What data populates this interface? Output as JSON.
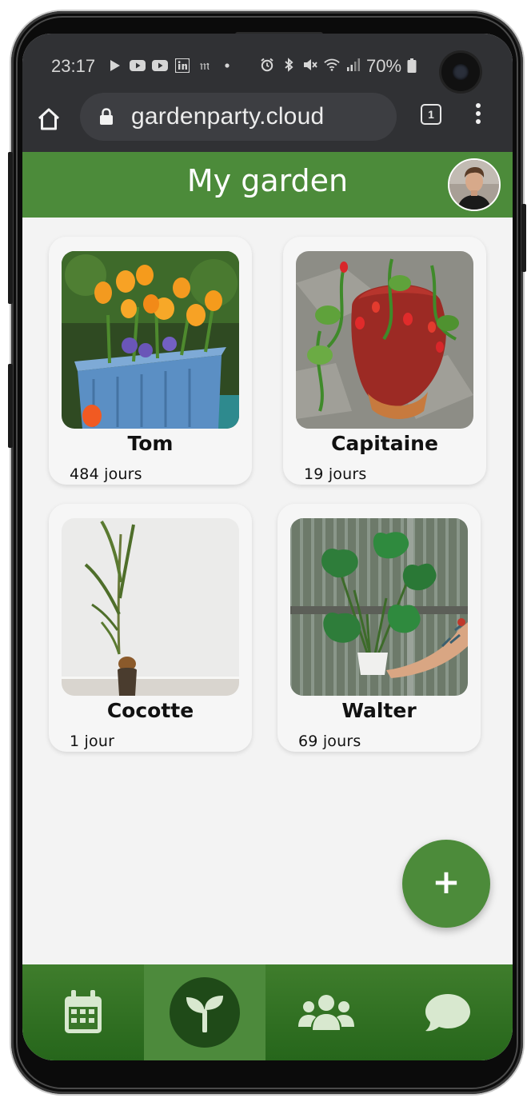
{
  "status_bar": {
    "time": "23:17",
    "battery": "70%",
    "left_icons": [
      "play-icon",
      "youtube-icon",
      "youtube-icon",
      "linkedin-icon",
      "medium-icon",
      "dot-icon"
    ],
    "right_icons": [
      "alarm-icon",
      "bluetooth-icon",
      "mute-icon",
      "wifi-icon",
      "signal-icon"
    ]
  },
  "browser": {
    "url": "gardenparty.cloud",
    "tab_count": "1"
  },
  "header": {
    "title": "My garden"
  },
  "plants": [
    {
      "name": "Tom",
      "age": "484 jours"
    },
    {
      "name": "Capitaine",
      "age": "19 jours"
    },
    {
      "name": "Cocotte",
      "age": "1 jour"
    },
    {
      "name": "Walter",
      "age": "69 jours"
    }
  ],
  "fab": {
    "label": "+"
  },
  "bottom_nav": {
    "items": [
      {
        "icon": "calendar-icon",
        "active": false
      },
      {
        "icon": "sprout-icon",
        "active": true
      },
      {
        "icon": "users-icon",
        "active": false
      },
      {
        "icon": "chat-bubble-icon",
        "active": false
      }
    ]
  },
  "colors": {
    "brand_green": "#4c8b3a",
    "nav_green": "#2f6f22",
    "nav_active": "#4d8a3c",
    "nav_active_circle": "#1f4a18",
    "browser_chrome": "#303134",
    "background": "#f3f3f3"
  }
}
